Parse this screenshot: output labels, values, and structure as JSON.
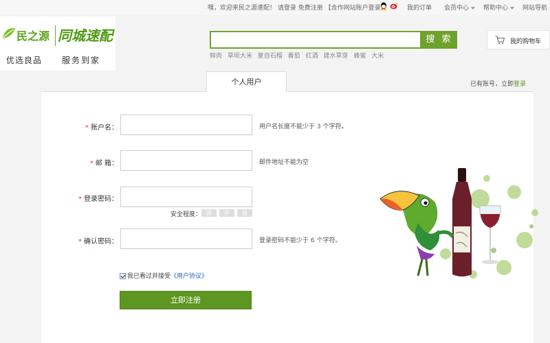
{
  "topbar": {
    "welcome_prefix": "嘿，欢迎来民之源速配！",
    "login": "请登录",
    "register": "免费注册",
    "partner": "【合作网站账户登录】",
    "qq_icon": "qq-icon",
    "weibo_icon": "weibo-icon",
    "my_orders": "我的订单",
    "member_center": "会员中心",
    "help_center": "帮助中心",
    "site_nav": "网站导航"
  },
  "logo": {
    "brand_main": "民之源",
    "brand_sub": "同城速配",
    "tagline_left": "优选良品",
    "tagline_right": "服务到家"
  },
  "search": {
    "placeholder": "",
    "button": "搜 索",
    "hotwords": [
      "鲜肉",
      "草坝大米",
      "蒙自石榴",
      "番茄",
      "红酒",
      "建水草芽",
      "蜂蜜",
      "大米"
    ]
  },
  "cart": {
    "label": "我的购物车"
  },
  "tabs": {
    "personal": "个人用户"
  },
  "login_hint": {
    "text": "已有账号，立即",
    "link": "登录"
  },
  "form": {
    "required_mark": "*",
    "username": {
      "label": "账户名：",
      "hint": "用户名长度不能少于 3 个字符。",
      "value": ""
    },
    "email": {
      "label": "邮 箱：",
      "hint": "邮件地址不能为空",
      "value": ""
    },
    "password": {
      "label": "登录密码：",
      "value": ""
    },
    "confirm": {
      "label": "确认密码：",
      "hint": "登录密码不能少于 6 个字符。",
      "value": ""
    },
    "strength": {
      "label": "安全程度：",
      "weak": "弱",
      "medium": "中",
      "strong": "强"
    },
    "agree": {
      "checked": true,
      "text": "我已看过并接受",
      "link": "《用户协议》"
    },
    "submit": "立即注册"
  },
  "colors": {
    "brand_green": "#6fa22c",
    "button_green": "#5d9621",
    "required_red": "#e33",
    "link_blue": "#2a64b7"
  }
}
